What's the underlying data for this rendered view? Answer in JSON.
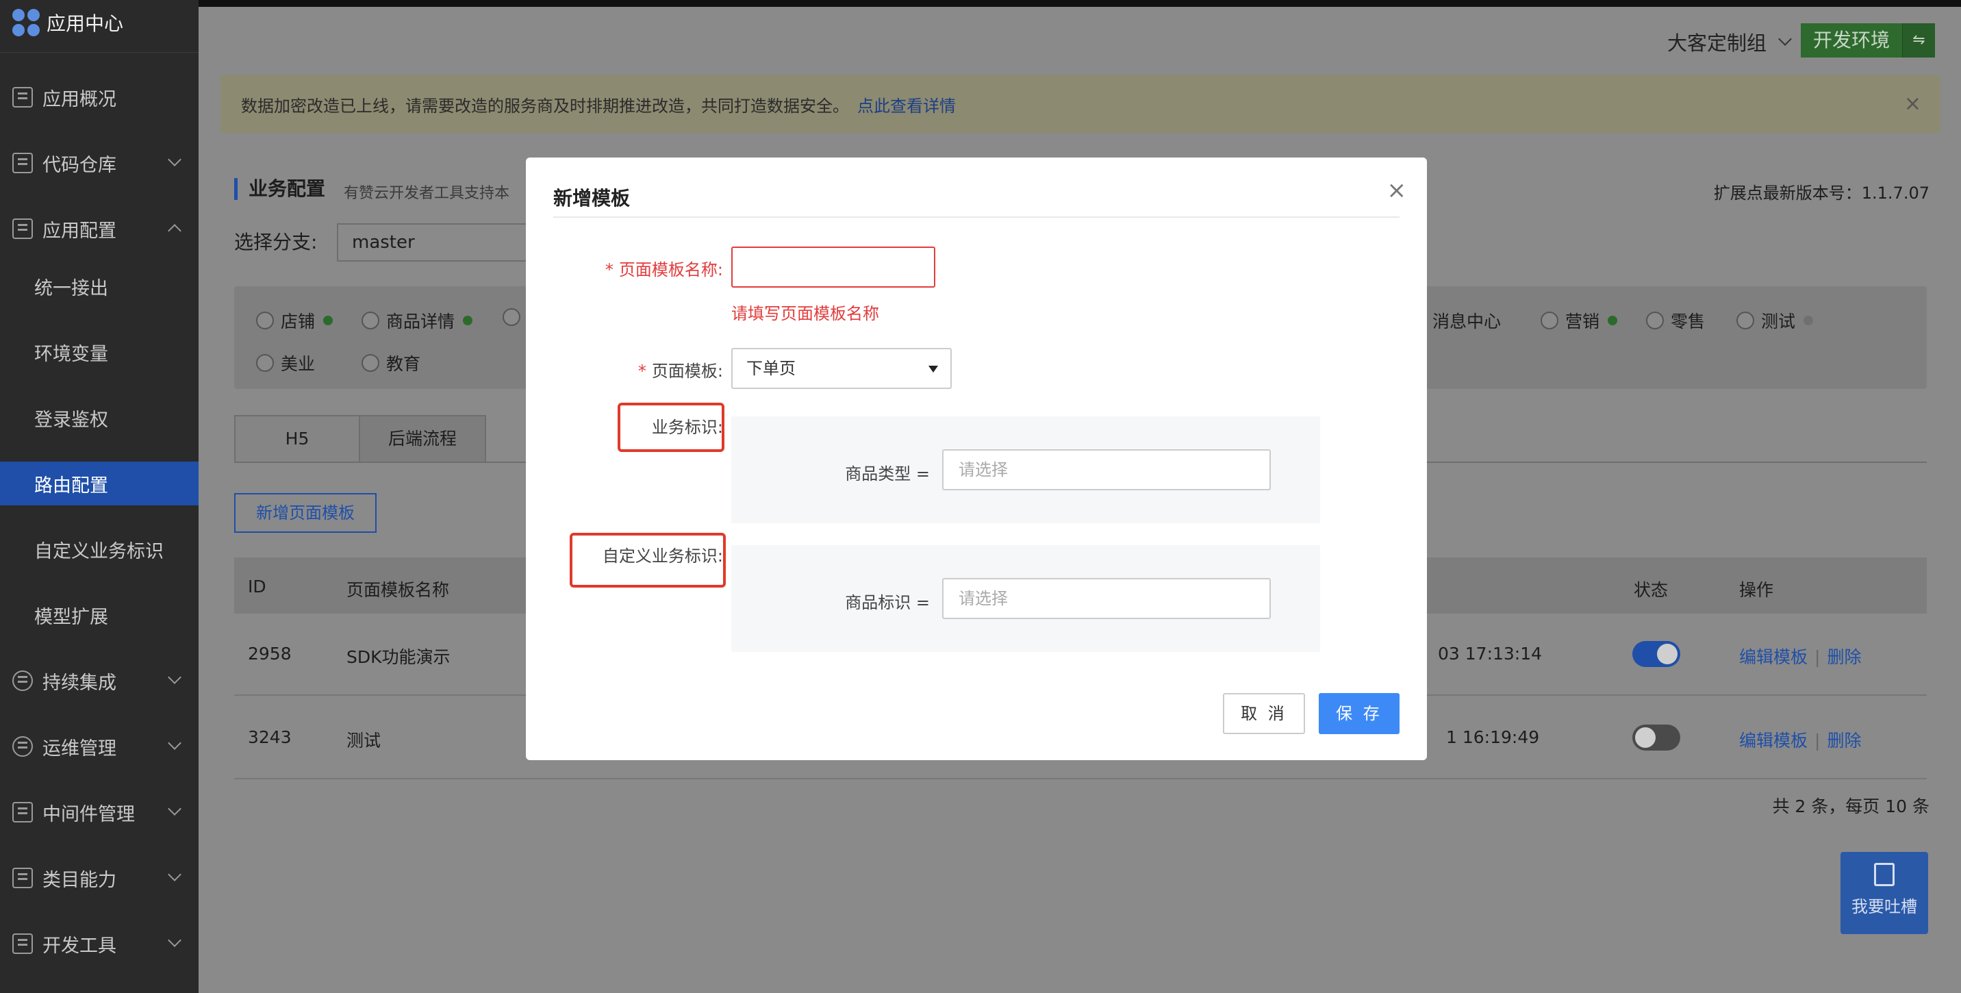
{
  "app": {
    "name": "应用中心"
  },
  "sidebar": {
    "items": [
      {
        "label": "应用概况",
        "has_children": false
      },
      {
        "label": "代码仓库",
        "has_children": true
      },
      {
        "label": "应用配置",
        "has_children": true
      },
      {
        "label": "统一接出",
        "sub": true
      },
      {
        "label": "环境变量",
        "sub": true
      },
      {
        "label": "登录鉴权",
        "sub": true
      },
      {
        "label": "路由配置",
        "sub": true,
        "active": true
      },
      {
        "label": "自定义业务标识",
        "sub": true
      },
      {
        "label": "模型扩展",
        "sub": true
      },
      {
        "label": "持续集成",
        "has_children": true
      },
      {
        "label": "运维管理",
        "has_children": true
      },
      {
        "label": "中间件管理",
        "has_children": true
      },
      {
        "label": "类目能力",
        "has_children": true
      },
      {
        "label": "开发工具",
        "has_children": true
      }
    ]
  },
  "header": {
    "team": "大客定制组",
    "env": "开发环境",
    "env_swap": "⇋"
  },
  "notice": {
    "text": "数据加密改造已上线，请需要改造的服务商及时排期推进改造，共同打造数据安全。",
    "link": "点此查看详情",
    "close": "×"
  },
  "card": {
    "title": "业务配置",
    "subtitle": "有赞云开发者工具支持本",
    "version": "扩展点最新版本号：1.1.7.07",
    "branch_label": "选择分支:",
    "branch_value": "master",
    "filters_row1": [
      {
        "label": "店铺",
        "dot": "green"
      },
      {
        "label": "商品详情",
        "dot": "green"
      },
      {
        "label": "",
        "dot": "none"
      },
      {
        "label": "消息中心",
        "dot": "none"
      },
      {
        "label": "营销",
        "dot": "green"
      },
      {
        "label": "零售",
        "dot": "none"
      },
      {
        "label": "测试",
        "dot": "grey"
      }
    ],
    "filters_row2": [
      {
        "label": "美业"
      },
      {
        "label": "教育"
      }
    ],
    "tabs": [
      "H5",
      "后端流程"
    ],
    "add_button": "新增页面模板",
    "table": {
      "headers": {
        "id": "ID",
        "name": "页面模板名称",
        "status": "状态",
        "ops": "操作"
      },
      "rows": [
        {
          "id": "2958",
          "name": "SDK功能演示",
          "time": "03 17:13:14",
          "on": true,
          "edit": "编辑模板",
          "delete": "删除"
        },
        {
          "id": "3243",
          "name": "测试",
          "time": "1 16:19:49",
          "on": false,
          "edit": "编辑模板",
          "delete": "删除"
        }
      ],
      "sep": "|"
    },
    "pager": "共 2 条，每页 10 条"
  },
  "feedback": {
    "label": "我要吐槽"
  },
  "modal": {
    "title": "新增模板",
    "close": "×",
    "name_label": "页面模板名称:",
    "name_value": "",
    "name_error": "请填写页面模板名称",
    "required_mark": "*",
    "template_label": "页面模板:",
    "template_value": "下单页",
    "biz_label": "业务标识:",
    "biz_field_label": "商品类型 =",
    "biz_placeholder": "请选择",
    "custom_label": "自定义业务标识:",
    "custom_field_label": "商品标识 =",
    "custom_placeholder": "请选择",
    "cancel": "取 消",
    "save": "保 存"
  },
  "colors": {
    "primary": "#3d8af7",
    "error": "#e23c3c",
    "highlight": "#e03a2b",
    "env_green": "#2e6a2e"
  }
}
